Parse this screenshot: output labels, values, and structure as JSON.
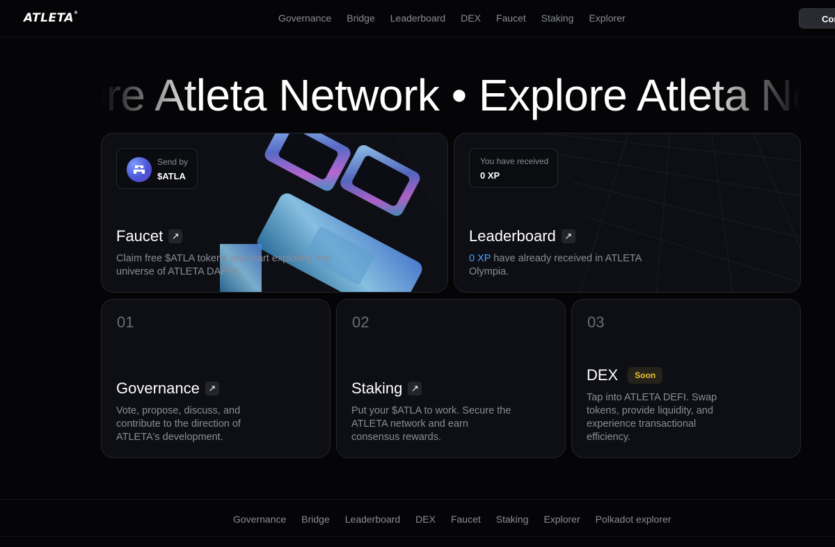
{
  "brand": {
    "logo": "ATLETA",
    "logo_mark": "®"
  },
  "nav": [
    "Governance",
    "Bridge",
    "Leaderboard",
    "DEX",
    "Faucet",
    "Staking",
    "Explorer"
  ],
  "connect_label": "Con",
  "marquee": "Explore Atleta Network • Explore Atleta Network • Explore Atleta Network",
  "faucet": {
    "badge_small": "Send by",
    "badge_big": "$ATLA",
    "title": "Faucet",
    "description": "Claim free $ATLA tokens and start exploring the universe of ATLETA DAPPs."
  },
  "leaderboard": {
    "badge_small": "You have received",
    "badge_big": "0 XP",
    "title": "Leaderboard",
    "xp_value": "0 XP",
    "description_rest": " have already received in ATLETA Olympia."
  },
  "features": [
    {
      "num": "01",
      "title": "Governance",
      "description": "Vote, propose, discuss, and contribute to the direction of ATLETA's development."
    },
    {
      "num": "02",
      "title": "Staking",
      "description": "Put your $ATLA to work. Secure the ATLETA network and earn consensus rewards."
    },
    {
      "num": "03",
      "title": "DEX",
      "badge": "Soon",
      "description": "Tap into ATLETA DEFI. Swap tokens, provide liquidity, and experience transactional efficiency."
    }
  ],
  "footer_nav": [
    "Governance",
    "Bridge",
    "Leaderboard",
    "DEX",
    "Faucet",
    "Staking",
    "Explorer",
    "Polkadot explorer"
  ],
  "colors": {
    "background": "#050507",
    "card": "#0e0f14",
    "accent_blue": "#4aa3ff",
    "soon_yellow": "#f1c232"
  }
}
